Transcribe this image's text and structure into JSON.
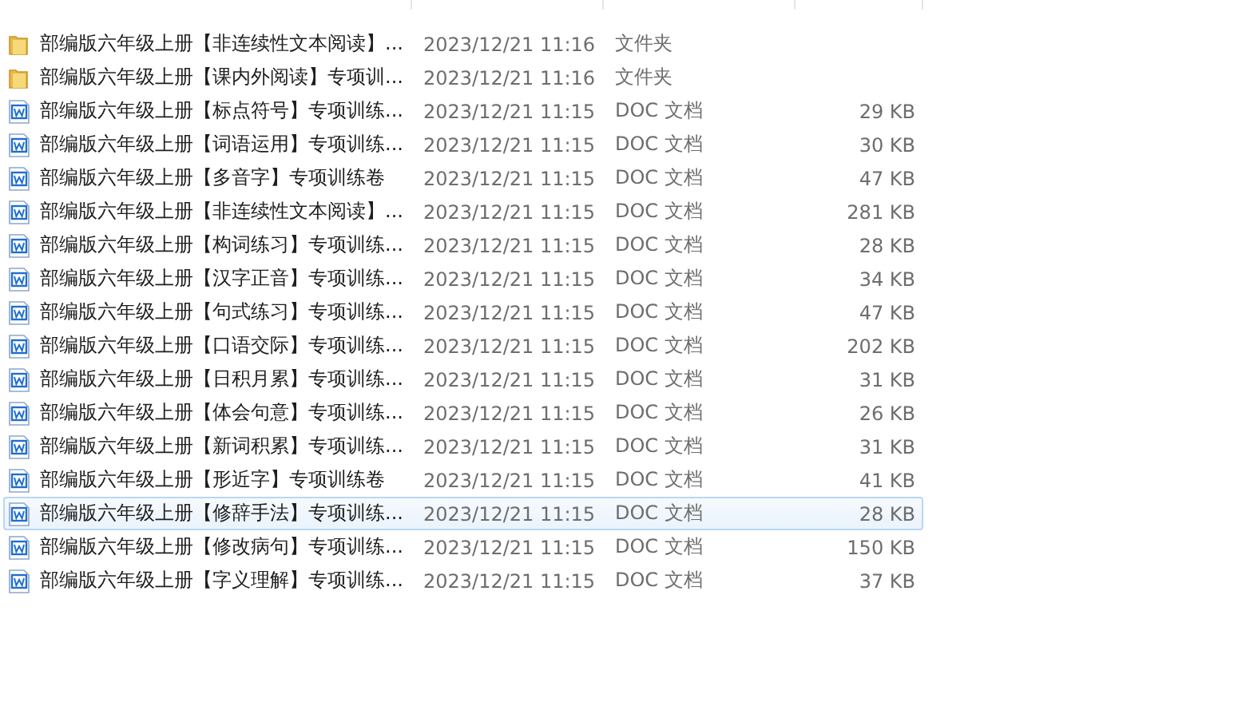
{
  "files": [
    {
      "kind": "folder",
      "name": "部编版六年级上册【非连续性文本阅读】...",
      "modified": "2023/12/21 11:16",
      "type": "文件夹",
      "selected": false
    },
    {
      "kind": "folder",
      "name": "部编版六年级上册【课内外阅读】专项训...",
      "modified": "2023/12/21 11:16",
      "type": "文件夹",
      "selected": false
    },
    {
      "kind": "doc",
      "name": "部编版六年级上册【标点符号】专项训练...",
      "modified": "2023/12/21 11:15",
      "type": "DOC 文档",
      "size": "29 KB",
      "selected": false
    },
    {
      "kind": "doc",
      "name": "部编版六年级上册【词语运用】专项训练...",
      "modified": "2023/12/21 11:15",
      "type": "DOC 文档",
      "size": "30 KB",
      "selected": false
    },
    {
      "kind": "doc",
      "name": "部编版六年级上册【多音字】专项训练卷",
      "modified": "2023/12/21 11:15",
      "type": "DOC 文档",
      "size": "47 KB",
      "selected": false
    },
    {
      "kind": "doc",
      "name": "部编版六年级上册【非连续性文本阅读】...",
      "modified": "2023/12/21 11:15",
      "type": "DOC 文档",
      "size": "281 KB",
      "selected": false
    },
    {
      "kind": "doc",
      "name": "部编版六年级上册【构词练习】专项训练...",
      "modified": "2023/12/21 11:15",
      "type": "DOC 文档",
      "size": "28 KB",
      "selected": false
    },
    {
      "kind": "doc",
      "name": "部编版六年级上册【汉字正音】专项训练...",
      "modified": "2023/12/21 11:15",
      "type": "DOC 文档",
      "size": "34 KB",
      "selected": false
    },
    {
      "kind": "doc",
      "name": "部编版六年级上册【句式练习】专项训练...",
      "modified": "2023/12/21 11:15",
      "type": "DOC 文档",
      "size": "47 KB",
      "selected": false
    },
    {
      "kind": "doc",
      "name": "部编版六年级上册【口语交际】专项训练...",
      "modified": "2023/12/21 11:15",
      "type": "DOC 文档",
      "size": "202 KB",
      "selected": false
    },
    {
      "kind": "doc",
      "name": "部编版六年级上册【日积月累】专项训练...",
      "modified": "2023/12/21 11:15",
      "type": "DOC 文档",
      "size": "31 KB",
      "selected": false
    },
    {
      "kind": "doc",
      "name": "部编版六年级上册【体会句意】专项训练...",
      "modified": "2023/12/21 11:15",
      "type": "DOC 文档",
      "size": "26 KB",
      "selected": false
    },
    {
      "kind": "doc",
      "name": "部编版六年级上册【新词积累】专项训练...",
      "modified": "2023/12/21 11:15",
      "type": "DOC 文档",
      "size": "31 KB",
      "selected": false
    },
    {
      "kind": "doc",
      "name": "部编版六年级上册【形近字】专项训练卷",
      "modified": "2023/12/21 11:15",
      "type": "DOC 文档",
      "size": "41 KB",
      "selected": false
    },
    {
      "kind": "doc",
      "name": "部编版六年级上册【修辞手法】专项训练...",
      "modified": "2023/12/21 11:15",
      "type": "DOC 文档",
      "size": "28 KB",
      "selected": true
    },
    {
      "kind": "doc",
      "name": "部编版六年级上册【修改病句】专项训练...",
      "modified": "2023/12/21 11:15",
      "type": "DOC 文档",
      "size": "150 KB",
      "selected": false
    },
    {
      "kind": "doc",
      "name": "部编版六年级上册【字义理解】专项训练...",
      "modified": "2023/12/21 11:15",
      "type": "DOC 文档",
      "size": "37 KB",
      "selected": false
    }
  ]
}
